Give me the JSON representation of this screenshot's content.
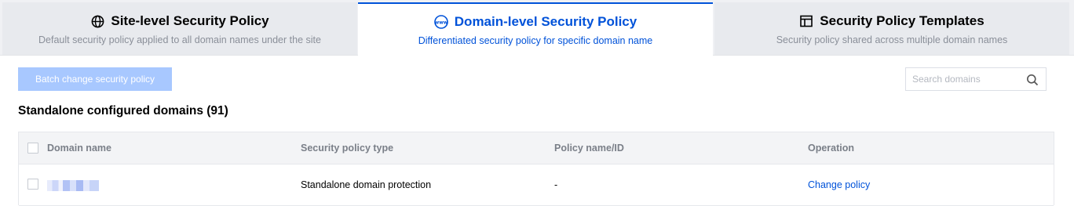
{
  "tabs": [
    {
      "title": "Site-level Security Policy",
      "desc": "Default security policy applied to all domain names under the site",
      "icon": "globe-icon"
    },
    {
      "title": "Domain-level Security Policy",
      "desc": "Differentiated security policy for specific domain name",
      "icon": "www-icon"
    },
    {
      "title": "Security Policy Templates",
      "desc": "Security policy shared across multiple domain names",
      "icon": "template-icon"
    }
  ],
  "toolbar": {
    "batch_label": "Batch change security policy",
    "search_placeholder": "Search domains"
  },
  "section": {
    "title": "Standalone configured domains (91)"
  },
  "table": {
    "headers": [
      "Domain name",
      "Security policy type",
      "Policy name/ID",
      "Operation"
    ],
    "rows": [
      {
        "domain": "",
        "type": "Standalone domain protection",
        "policy": "-",
        "operation": "Change policy"
      }
    ]
  },
  "colors": {
    "accent": "#0052d9",
    "disabled_button": "#a8c8ff",
    "tab_bg": "#e8eaee"
  }
}
